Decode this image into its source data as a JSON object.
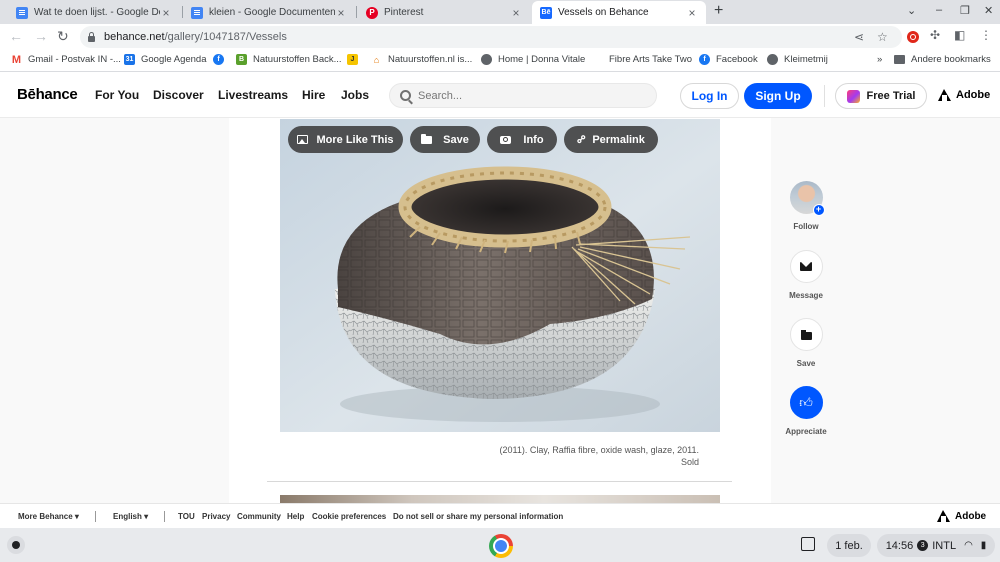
{
  "tabs": [
    {
      "title": "Wat te doen lijst. - Google Docum",
      "icon": "google-docs-icon",
      "active": false
    },
    {
      "title": "kleien - Google Documenten",
      "icon": "google-docs-icon",
      "active": false
    },
    {
      "title": "Pinterest",
      "icon": "pinterest-icon",
      "active": false
    },
    {
      "title": "Vessels on Behance",
      "icon": "behance-icon",
      "active": true
    }
  ],
  "address_bar": {
    "host": "behance.net",
    "path": "/gallery/1047187/Vessels"
  },
  "bookmarks": [
    {
      "label": "Gmail - Postvak IN -...",
      "icon": "gmail-icon"
    },
    {
      "label": "Google Agenda",
      "icon": "google-calendar-icon"
    },
    {
      "label": "",
      "icon": "facebook-icon"
    },
    {
      "label": "Natuurstoffen Back...",
      "icon": "green-b-icon"
    },
    {
      "label": "",
      "icon": "yellow-j-icon"
    },
    {
      "label": "Natuurstoffen.nl is...",
      "icon": "natuurstoffen-icon"
    },
    {
      "label": "Home | Donna Vitale",
      "icon": "globe-icon"
    },
    {
      "label": "Fibre Arts Take Two",
      "icon": "blank-icon"
    },
    {
      "label": "Facebook",
      "icon": "facebook-icon"
    },
    {
      "label": "Kleimetmij",
      "icon": "globe-icon"
    }
  ],
  "bookmarks_overflow": "»",
  "other_bookmarks": "Andere bookmarks",
  "behance": {
    "logo": "Bēhance",
    "nav": [
      "For You",
      "Discover",
      "Livestreams",
      "Hire",
      "Jobs"
    ],
    "search_placeholder": "Search...",
    "login": "Log In",
    "signup": "Sign Up",
    "free_trial": "Free Trial",
    "adobe": "Adobe"
  },
  "artwork_actions": [
    {
      "label": "More Like This",
      "icon": "image-icon"
    },
    {
      "label": "Save",
      "icon": "folder-icon"
    },
    {
      "label": "Info",
      "icon": "camera-icon"
    },
    {
      "label": "Permalink",
      "icon": "link-icon"
    }
  ],
  "caption": {
    "line1": "(2011). Clay, Raffia fibre, oxide wash, glaze, 2011.",
    "line2": "Sold"
  },
  "sidebar": [
    {
      "label": "Follow",
      "icon": "avatar"
    },
    {
      "label": "Message",
      "icon": "envelope-icon"
    },
    {
      "label": "Save",
      "icon": "folder-icon"
    },
    {
      "label": "Appreciate",
      "icon": "thumbs-up-icon"
    }
  ],
  "footer": {
    "more_behance": "More Behance ▾",
    "language": "English ▾",
    "links": [
      "TOU",
      "Privacy",
      "Community",
      "Help",
      "Cookie preferences",
      "Do not sell or share my personal information"
    ],
    "adobe": "Adobe"
  },
  "shelf": {
    "date": "1 feb.",
    "time": "14:56",
    "notifications": "3",
    "input_method": "INTL"
  },
  "colors": {
    "behance_blue": "#0057ff",
    "chrome_tabstrip": "#dfe1e5",
    "shelf": "#e8eaed"
  }
}
